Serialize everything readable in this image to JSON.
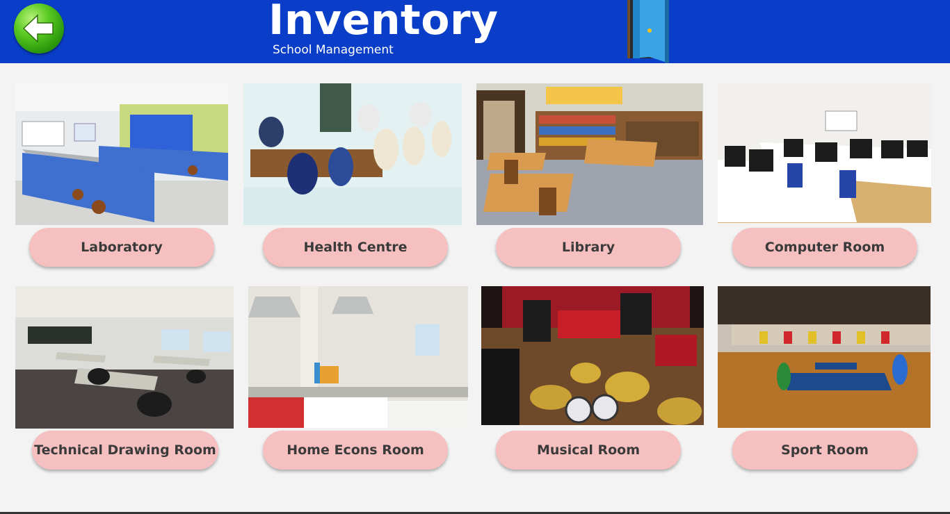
{
  "header": {
    "title": "Inventory",
    "subtitle": "School Management",
    "back_icon": "back-arrow-icon",
    "door_icon": "door-icon",
    "background_color": "#0a3ec8"
  },
  "rooms": [
    {
      "label": "Laboratory",
      "image": "laboratory-photo"
    },
    {
      "label": "Health Centre",
      "image": "health-centre-photo"
    },
    {
      "label": "Library",
      "image": "library-photo"
    },
    {
      "label": "Computer Room",
      "image": "computer-room-photo"
    },
    {
      "label": "Technical Drawing Room",
      "image": "technical-drawing-room-photo"
    },
    {
      "label": "Home Econs Room",
      "image": "home-econs-room-photo"
    },
    {
      "label": "Musical Room",
      "image": "musical-room-photo"
    },
    {
      "label": "Sport Room",
      "image": "sport-room-photo"
    }
  ],
  "colors": {
    "button_bg": "#f6c0c0",
    "button_text": "#3a3a3a",
    "page_bg": "#f3f3f3"
  }
}
